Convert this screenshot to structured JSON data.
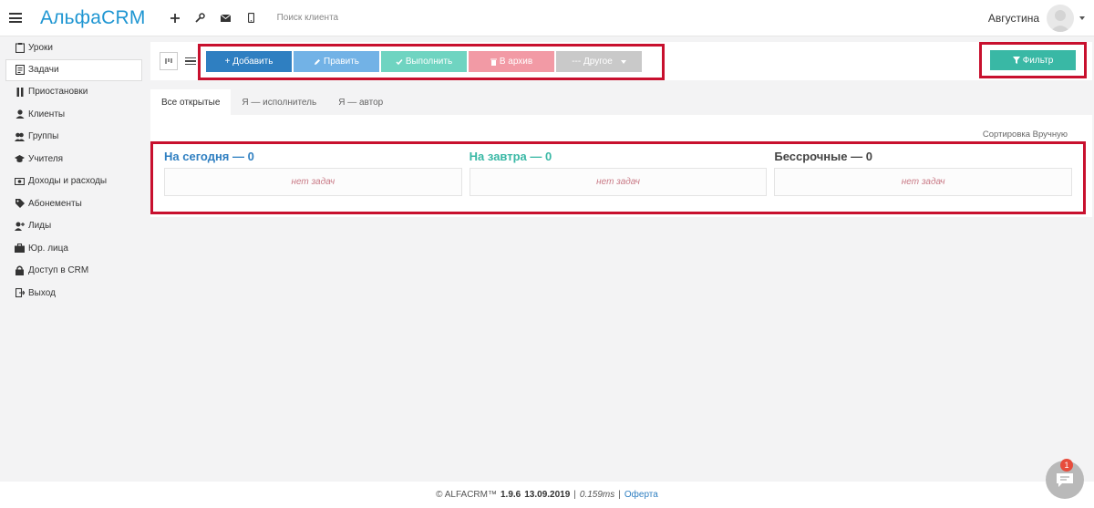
{
  "header": {
    "logo": "АльфаCRM",
    "search_placeholder": "Поиск клиента",
    "user_name": "Августина"
  },
  "sidebar": {
    "items": [
      {
        "label": "Уроки",
        "icon": "clipboard-icon"
      },
      {
        "label": "Задачи",
        "icon": "tasks-icon",
        "active": true
      },
      {
        "label": "Приостановки",
        "icon": "pause-icon"
      },
      {
        "label": "Клиенты",
        "icon": "user-icon"
      },
      {
        "label": "Группы",
        "icon": "users-icon"
      },
      {
        "label": "Учителя",
        "icon": "graduation-cap-icon"
      },
      {
        "label": "Доходы и расходы",
        "icon": "money-icon"
      },
      {
        "label": "Абонементы",
        "icon": "tag-icon"
      },
      {
        "label": "Лиды",
        "icon": "user-plus-icon"
      },
      {
        "label": "Юр. лица",
        "icon": "briefcase-icon"
      },
      {
        "label": "Доступ в CRM",
        "icon": "lock-icon"
      },
      {
        "label": "Выход",
        "icon": "sign-out-icon"
      }
    ]
  },
  "toolbar": {
    "add": "+ Добавить",
    "edit": "Править",
    "done": "Выполнить",
    "archive": "В архив",
    "other": "--- Другое",
    "filter": "Фильтр"
  },
  "tabs": [
    {
      "label": "Все открытые",
      "active": true
    },
    {
      "label": "Я — исполнитель"
    },
    {
      "label": "Я — автор"
    }
  ],
  "panel": {
    "sort": "Сортировка Вручную",
    "columns": [
      {
        "title": "На сегодня — 0",
        "empty": "нет задач"
      },
      {
        "title": "На завтра — 0",
        "empty": "нет задач"
      },
      {
        "title": "Бессрочные — 0",
        "empty": "нет задач"
      }
    ]
  },
  "footer": {
    "copyright": "© ALFACRM™",
    "version": "1.9.6",
    "date": "13.09.2019",
    "sep1": "|",
    "time": "0.159ms",
    "sep2": "|",
    "link": "Оферта"
  },
  "chat": {
    "badge": "1"
  },
  "colors": {
    "accent": "#1f96d2",
    "add": "#2f7fc1",
    "filter": "#39b8a5",
    "highlight": "#c8102e"
  }
}
